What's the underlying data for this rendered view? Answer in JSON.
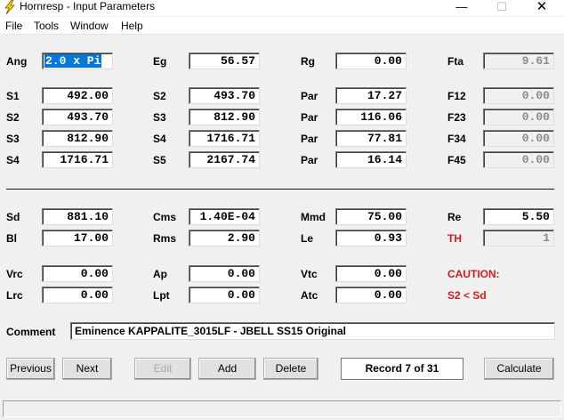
{
  "window": {
    "title": "Hornresp - Input Parameters",
    "min_glyph": "—",
    "max_glyph": "☐",
    "close_glyph": "✕"
  },
  "menu": [
    "File",
    "Tools",
    "Window",
    "Help"
  ],
  "rows": {
    "ang": {
      "label": "Ang",
      "value": "2.0 x Pi"
    },
    "eg": {
      "label": "Eg",
      "value": "56.57"
    },
    "rg": {
      "label": "Rg",
      "value": "0.00"
    },
    "fta": {
      "label": "Fta",
      "value": "9.61"
    },
    "s1": {
      "label": "S1",
      "value": "492.00"
    },
    "s2a": {
      "label": "S2",
      "value": "493.70"
    },
    "par1": {
      "label": "Par",
      "value": "17.27"
    },
    "f12": {
      "label": "F12",
      "value": "0.00"
    },
    "s2b": {
      "label": "S2",
      "value": "493.70"
    },
    "s3a": {
      "label": "S3",
      "value": "812.90"
    },
    "par2": {
      "label": "Par",
      "value": "116.06"
    },
    "f23": {
      "label": "F23",
      "value": "0.00"
    },
    "s3b": {
      "label": "S3",
      "value": "812.90"
    },
    "s4a": {
      "label": "S4",
      "value": "1716.71"
    },
    "par3": {
      "label": "Par",
      "value": "77.81"
    },
    "f34": {
      "label": "F34",
      "value": "0.00"
    },
    "s4b": {
      "label": "S4",
      "value": "1716.71"
    },
    "s5": {
      "label": "S5",
      "value": "2167.74"
    },
    "par4": {
      "label": "Par",
      "value": "16.14"
    },
    "f45": {
      "label": "F45",
      "value": "0.00"
    },
    "sd": {
      "label": "Sd",
      "value": "881.10"
    },
    "cms": {
      "label": "Cms",
      "value": "1.40E-04"
    },
    "mmd": {
      "label": "Mmd",
      "value": "75.00"
    },
    "re": {
      "label": "Re",
      "value": "5.50"
    },
    "bl": {
      "label": "Bl",
      "value": "17.00"
    },
    "rms": {
      "label": "Rms",
      "value": "2.90"
    },
    "le": {
      "label": "Le",
      "value": "0.93"
    },
    "th": {
      "label": "TH",
      "value": "1"
    },
    "vrc": {
      "label": "Vrc",
      "value": "0.00"
    },
    "ap": {
      "label": "Ap",
      "value": "0.00"
    },
    "vtc": {
      "label": "Vtc",
      "value": "0.00"
    },
    "lrc": {
      "label": "Lrc",
      "value": "0.00"
    },
    "lpt": {
      "label": "Lpt",
      "value": "0.00"
    },
    "atc": {
      "label": "Atc",
      "value": "0.00"
    }
  },
  "caution": {
    "title": "CAUTION:",
    "message": "S2 < Sd"
  },
  "comment": {
    "label": "Comment",
    "value": "Eminence KAPPALITE_3015LF - JBELL SS15 Original"
  },
  "buttons": {
    "previous": "Previous",
    "next": "Next",
    "edit": "Edit",
    "add": "Add",
    "delete": "Delete",
    "calculate": "Calculate"
  },
  "record": "Record 7 of 31",
  "colors": {
    "caution": "#d21c1c",
    "selection": "#0078d7",
    "readonly_text": "#8c8c8c"
  }
}
